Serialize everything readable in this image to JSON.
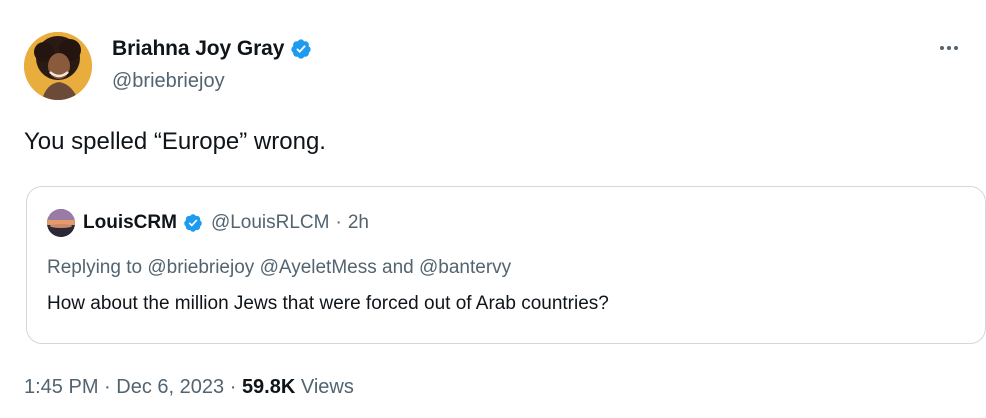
{
  "author": {
    "display_name": "Briahna Joy Gray",
    "handle": "@briebriejoy",
    "verified": true
  },
  "tweet": {
    "text": "You spelled “Europe” wrong."
  },
  "quoted_tweet": {
    "display_name": "LouisCRM",
    "handle": "@LouisRLCM",
    "separator": "·",
    "time": "2h",
    "replying_prefix": "Replying to",
    "reply_mention_1": "@briebriejoy",
    "reply_mention_2": "@AyeletMess",
    "reply_and": "and",
    "reply_mention_3": "@bantervy",
    "text": "How about the million Jews that were forced out of Arab countries?"
  },
  "meta": {
    "time": "1:45 PM",
    "separator_1": "·",
    "date": "Dec 6, 2023",
    "separator_2": "·",
    "views_count": "59.8K",
    "views_label": "Views"
  },
  "colors": {
    "verified_blue": "#1d9bf0",
    "secondary_text": "#536471",
    "primary_text": "#0f1419",
    "border": "#cfd9de"
  },
  "icons": {
    "verified": "verified-badge-icon",
    "more": "more-options-icon"
  }
}
